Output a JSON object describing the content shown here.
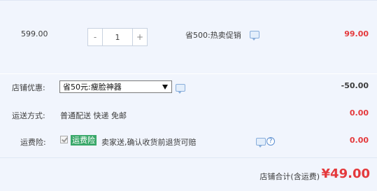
{
  "item": {
    "unit_price": "599.00",
    "quantity": "1",
    "minus_label": "-",
    "plus_label": "+",
    "promotion": "省500:热卖促销",
    "subtotal": "99.00"
  },
  "shop_discount": {
    "label": "店铺优惠:",
    "selected_option": "省50元:瘦脸神器",
    "amount": "-50.00"
  },
  "shipping": {
    "label": "运送方式:",
    "method": "普通配送 快递 免邮",
    "amount": "0.00"
  },
  "shipping_insurance": {
    "label": "运费险:",
    "badge": "运费险",
    "description": "卖家送,确认收货前退货可赔",
    "help_glyph": "?",
    "amount": "0.00"
  },
  "shop_total": {
    "label": "店铺合计(含运费)",
    "value": "¥49.00"
  },
  "colors": {
    "accent_red": "#e4393c",
    "band_bg": "#f1f5fd",
    "badge_green": "#3aa86a",
    "link_blue": "#3b78c7"
  },
  "icons": [
    "chat-icon",
    "help-icon",
    "checkbox-check-icon",
    "chevron-down-icon"
  ]
}
